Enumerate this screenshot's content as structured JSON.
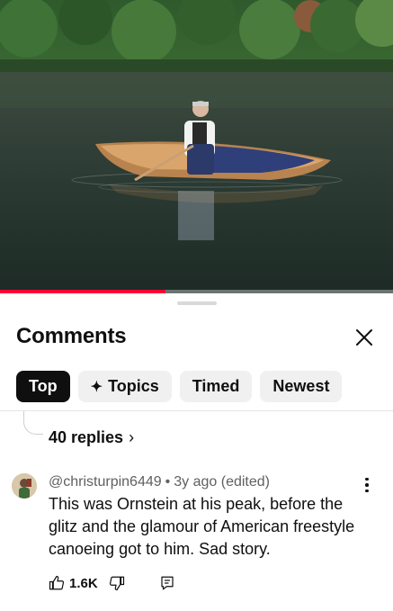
{
  "video": {
    "progress_percent": 42
  },
  "comments_panel": {
    "title": "Comments",
    "close_icon": "close-icon",
    "filters": [
      {
        "label": "Top",
        "active": true
      },
      {
        "label": "Topics",
        "icon": "sparkle-icon",
        "active": false
      },
      {
        "label": "Timed",
        "active": false
      },
      {
        "label": "Newest",
        "active": false
      }
    ],
    "previous_thread": {
      "replies_label": "40 replies",
      "chevron": "›"
    },
    "comment": {
      "author": "@christurpin6449",
      "separator": "•",
      "time": "3y ago (edited)",
      "text": "This was Ornstein at his peak, before the glitz and the glamour of American freestyle canoeing got to him. Sad story.",
      "like_count": "1.6K"
    }
  },
  "colors": {
    "progress": "#ff0033",
    "chip_active_bg": "#0f0f0f",
    "chip_bg": "#f0f0f0",
    "meta_text": "#606060"
  }
}
